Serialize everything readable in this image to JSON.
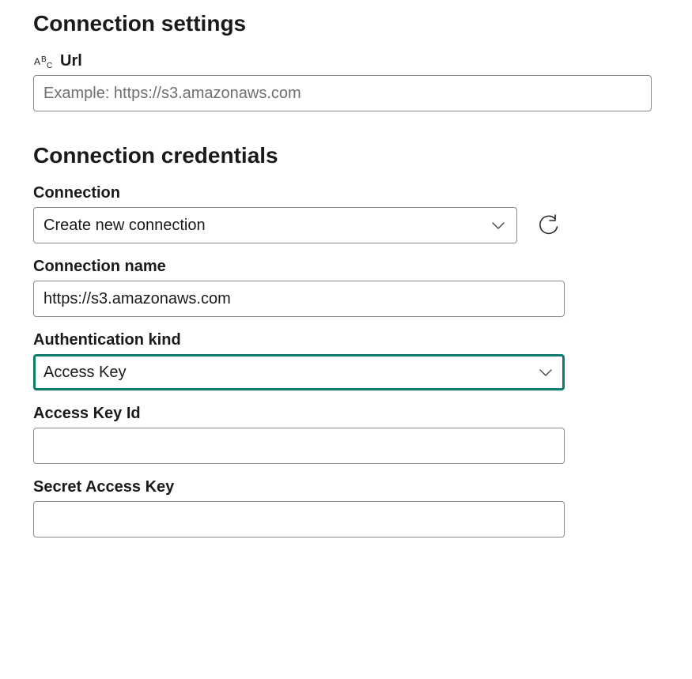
{
  "settings": {
    "heading": "Connection settings",
    "url_label": "Url",
    "url_placeholder": "Example: https://s3.amazonaws.com",
    "url_value": ""
  },
  "credentials": {
    "heading": "Connection credentials",
    "connection_label": "Connection",
    "connection_value": "Create new connection",
    "connection_name_label": "Connection name",
    "connection_name_value": "https://s3.amazonaws.com",
    "auth_kind_label": "Authentication kind",
    "auth_kind_value": "Access Key",
    "access_key_id_label": "Access Key Id",
    "access_key_id_value": "",
    "secret_access_key_label": "Secret Access Key",
    "secret_access_key_value": ""
  }
}
